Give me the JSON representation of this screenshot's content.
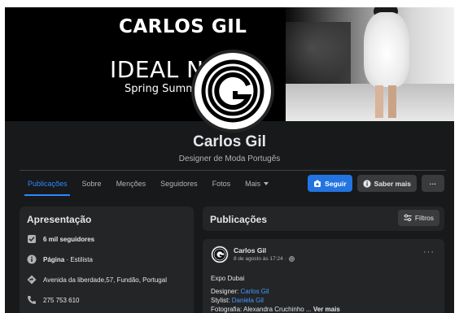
{
  "cover": {
    "brand": "CARLOS GIL",
    "title": "IDEAL NAT",
    "subtitle": "Spring Summe"
  },
  "profile": {
    "name": "Carlos Gil",
    "category": "Designer de Moda Portugês"
  },
  "tabs": [
    {
      "label": "Publicações",
      "active": true
    },
    {
      "label": "Sobre"
    },
    {
      "label": "Menções"
    },
    {
      "label": "Seguidores"
    },
    {
      "label": "Fotos"
    },
    {
      "label": "Mais"
    }
  ],
  "actions": {
    "follow_label": "Seguir",
    "learn_more_label": "Saber mais",
    "more_label": "···"
  },
  "intro": {
    "title": "Apresentação",
    "followers": "6 mil seguidores",
    "page_type_label": "Página",
    "page_type_value": " · Estilista",
    "address": "Avenida da liberdade,57, Fundão, Portugal",
    "phone": "275 753 610"
  },
  "posts": {
    "title": "Publicações",
    "filters_label": "Filtros",
    "post": {
      "author": "Carlos Gil",
      "date": "8 de agosto às 17:24 ·",
      "menu": "···",
      "line1": "Expo Dubai",
      "designer_label": "Designer: ",
      "designer_name": "Carlos Gil",
      "stylist_label": "Stylist: ",
      "stylist_name": "Daniela Gil",
      "photo_text": "Fotografia: Alexandra Cruchinho ... ",
      "see_more": "Ver mais"
    }
  },
  "colors": {
    "background": "#18191a",
    "card": "#242526",
    "accent": "#2d88ff",
    "primary_button": "#2374e1",
    "secondary_button": "#3a3b3c",
    "text_primary": "#e4e6eb",
    "text_secondary": "#b0b3b8"
  },
  "icons": {
    "followers": "followers-icon",
    "page": "info-icon",
    "address": "location-icon",
    "phone": "phone-icon",
    "follow": "follow-icon",
    "learn_more": "info-icon",
    "filters": "filter-icon",
    "privacy": "globe-icon"
  }
}
